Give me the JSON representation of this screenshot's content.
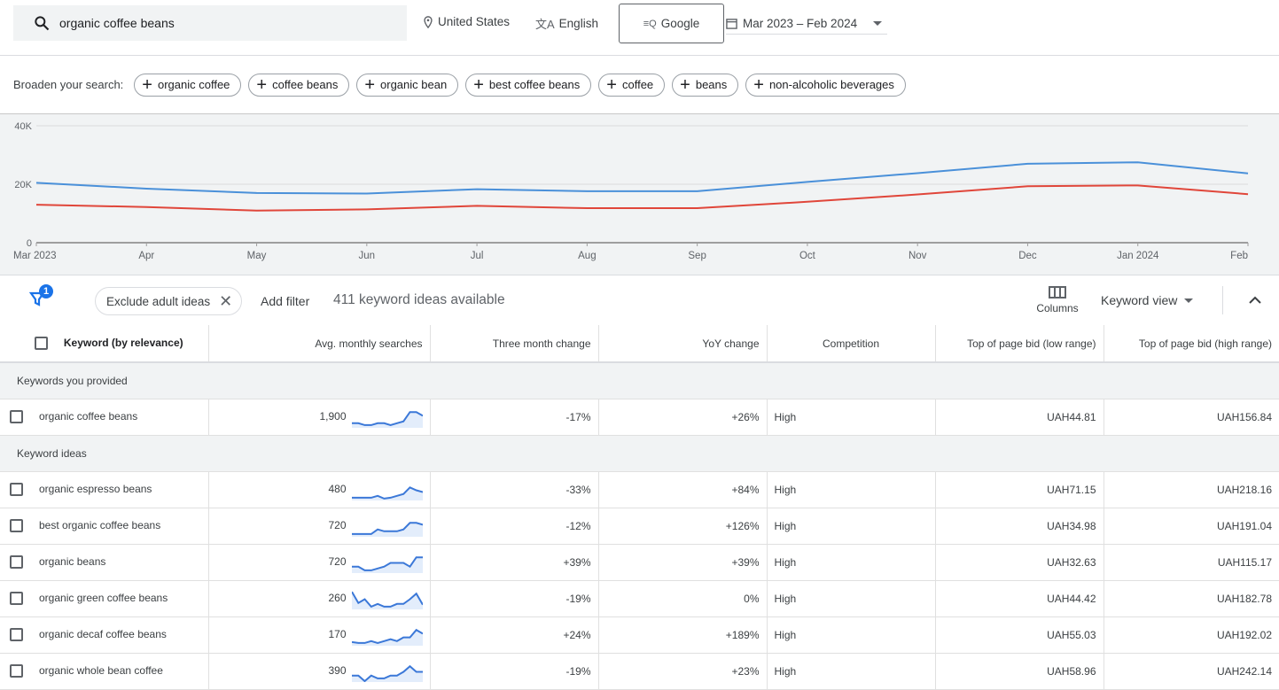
{
  "header": {
    "search_value": "organic coffee beans",
    "location": "United States",
    "language": "English",
    "network": "Google",
    "date_range": "Mar 2023 – Feb 2024"
  },
  "broaden": {
    "label": "Broaden your search:",
    "chips": [
      "organic coffee",
      "coffee beans",
      "organic bean",
      "best coffee beans",
      "coffee",
      "beans",
      "non-alcoholic beverages"
    ]
  },
  "chart_data": {
    "type": "line",
    "x": [
      "Mar 2023",
      "Apr",
      "May",
      "Jun",
      "Jul",
      "Aug",
      "Sep",
      "Oct",
      "Nov",
      "Dec",
      "Jan 2024",
      "Feb"
    ],
    "yticks": [
      "0",
      "20K",
      "40K"
    ],
    "ylim": [
      0,
      40000
    ],
    "grid": true,
    "series": [
      {
        "color": "#4a90d9",
        "values": [
          20500,
          18500,
          17000,
          16800,
          18300,
          17600,
          17600,
          20800,
          23800,
          27000,
          27500,
          23700
        ]
      },
      {
        "color": "#e0463a",
        "values": [
          13000,
          12200,
          11000,
          11400,
          12600,
          11800,
          11800,
          14000,
          16500,
          19300,
          19600,
          16600
        ]
      }
    ]
  },
  "toolbar": {
    "filter_count": "1",
    "filter_chip": "Exclude adult ideas",
    "add_filter": "Add filter",
    "ideas_count": "411 keyword ideas available",
    "columns": "Columns",
    "view": "Keyword view"
  },
  "table": {
    "headers": [
      "Keyword (by relevance)",
      "Avg. monthly searches",
      "Three month change",
      "YoY change",
      "Competition",
      "Top of page bid (low range)",
      "Top of page bid (high range)"
    ],
    "groups": [
      {
        "label": "Keywords you provided",
        "rows": [
          {
            "keyword": "organic coffee beans",
            "searches": "1,900",
            "three_month": "-17%",
            "yoy": "+26%",
            "competition": "High",
            "bid_low": "UAH44.81",
            "bid_high": "UAH156.84",
            "trend": [
              2,
              2,
              1,
              1,
              2,
              2,
              1,
              2,
              3,
              8,
              8,
              6
            ]
          }
        ]
      },
      {
        "label": "Keyword ideas",
        "rows": [
          {
            "keyword": "organic espresso beans",
            "searches": "480",
            "three_month": "-33%",
            "yoy": "+84%",
            "competition": "High",
            "bid_low": "UAH71.15",
            "bid_high": "UAH218.16",
            "trend": [
              1,
              1,
              1,
              1,
              2,
              0.5,
              1,
              2,
              3,
              6.5,
              5,
              4
            ]
          },
          {
            "keyword": "best organic coffee beans",
            "searches": "720",
            "three_month": "-12%",
            "yoy": "+126%",
            "competition": "High",
            "bid_low": "UAH34.98",
            "bid_high": "UAH191.04",
            "trend": [
              1,
              1,
              1,
              1,
              3.5,
              2.5,
              2.5,
              2.5,
              3.5,
              7,
              7,
              6
            ]
          },
          {
            "keyword": "organic beans",
            "searches": "720",
            "three_month": "+39%",
            "yoy": "+39%",
            "competition": "High",
            "bid_low": "UAH32.63",
            "bid_high": "UAH115.17",
            "trend": [
              3,
              3,
              1,
              1,
              2,
              3,
              5,
              5,
              5,
              3,
              8,
              8
            ]
          },
          {
            "keyword": "organic green coffee beans",
            "searches": "260",
            "three_month": "-19%",
            "yoy": "0%",
            "competition": "High",
            "bid_low": "UAH44.42",
            "bid_high": "UAH182.78",
            "trend": [
              9,
              3,
              5,
              1,
              2.5,
              1,
              1,
              2.5,
              2.5,
              5,
              8,
              2
            ]
          },
          {
            "keyword": "organic decaf coffee beans",
            "searches": "170",
            "three_month": "+24%",
            "yoy": "+189%",
            "competition": "High",
            "bid_low": "UAH55.03",
            "bid_high": "UAH192.02",
            "trend": [
              1.5,
              1,
              1,
              2,
              1,
              2,
              3,
              2,
              4,
              4,
              8,
              6
            ]
          },
          {
            "keyword": "organic whole bean coffee",
            "searches": "390",
            "three_month": "-19%",
            "yoy": "+23%",
            "competition": "High",
            "bid_low": "UAH58.96",
            "bid_high": "UAH242.14",
            "trend": [
              3,
              3,
              0,
              3,
              1.5,
              1.5,
              3,
              3,
              5,
              8,
              5,
              5
            ]
          }
        ]
      }
    ]
  }
}
